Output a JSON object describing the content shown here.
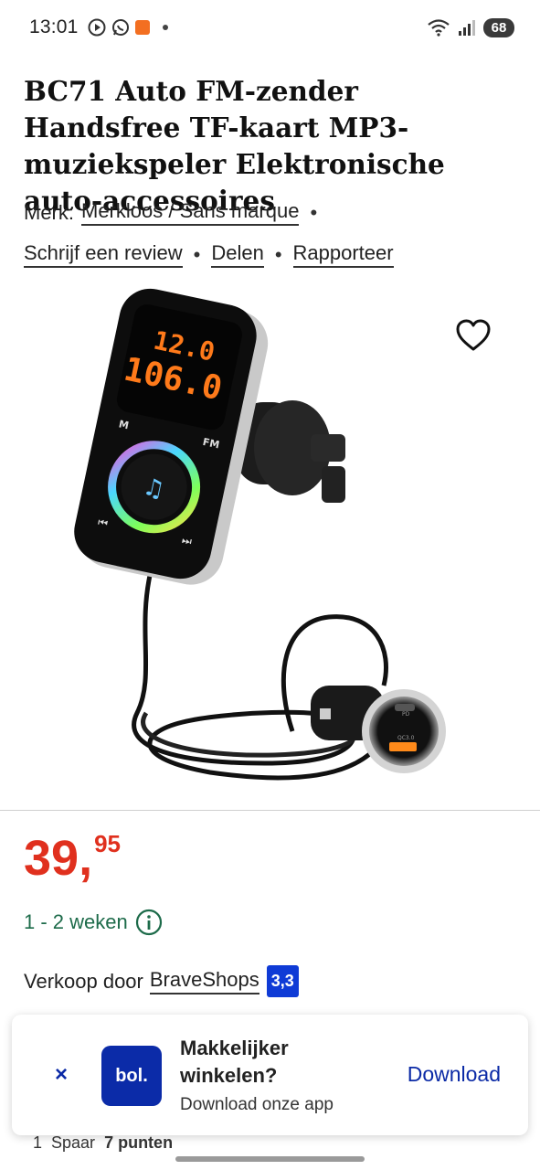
{
  "status_bar": {
    "time": "13:01",
    "battery": "68",
    "icons": [
      "play-circle-icon",
      "whatsapp-icon",
      "app-badge-icon",
      "wifi-icon",
      "signal-icon"
    ]
  },
  "product": {
    "title": "BC71 Auto FM-zender Handsfree TF-kaart MP3-muziekspeler Elektronische auto-accessoires",
    "brand_prefix": "Merk:",
    "brand_name": "Merkloos / Sans marque",
    "links": {
      "review": "Schrijf een review",
      "share": "Delen",
      "report": "Rapporteer"
    },
    "device_display": {
      "line1": "12.0",
      "line2": "106.0",
      "mode_label": "M",
      "fm_label": "FM",
      "usb_label": "QC3.0",
      "pd_label": "PD"
    },
    "price_main": "39,",
    "price_cents": "95",
    "delivery": "1 - 2 weken",
    "seller_prefix": "Verkoop door",
    "seller_name": "BraveShops",
    "seller_rating": "3,3"
  },
  "app_banner": {
    "close": "×",
    "logo_text": "bol.",
    "title": "Makkelijker winkelen?",
    "subtitle": "Download onze app",
    "download": "Download"
  },
  "peek": {
    "badge": "1",
    "text_prefix": "Spaar",
    "points": "7 punten"
  },
  "colors": {
    "price": "#e0301e",
    "delivery": "#1d6b4a",
    "brand_blue": "#0b2aa6"
  }
}
